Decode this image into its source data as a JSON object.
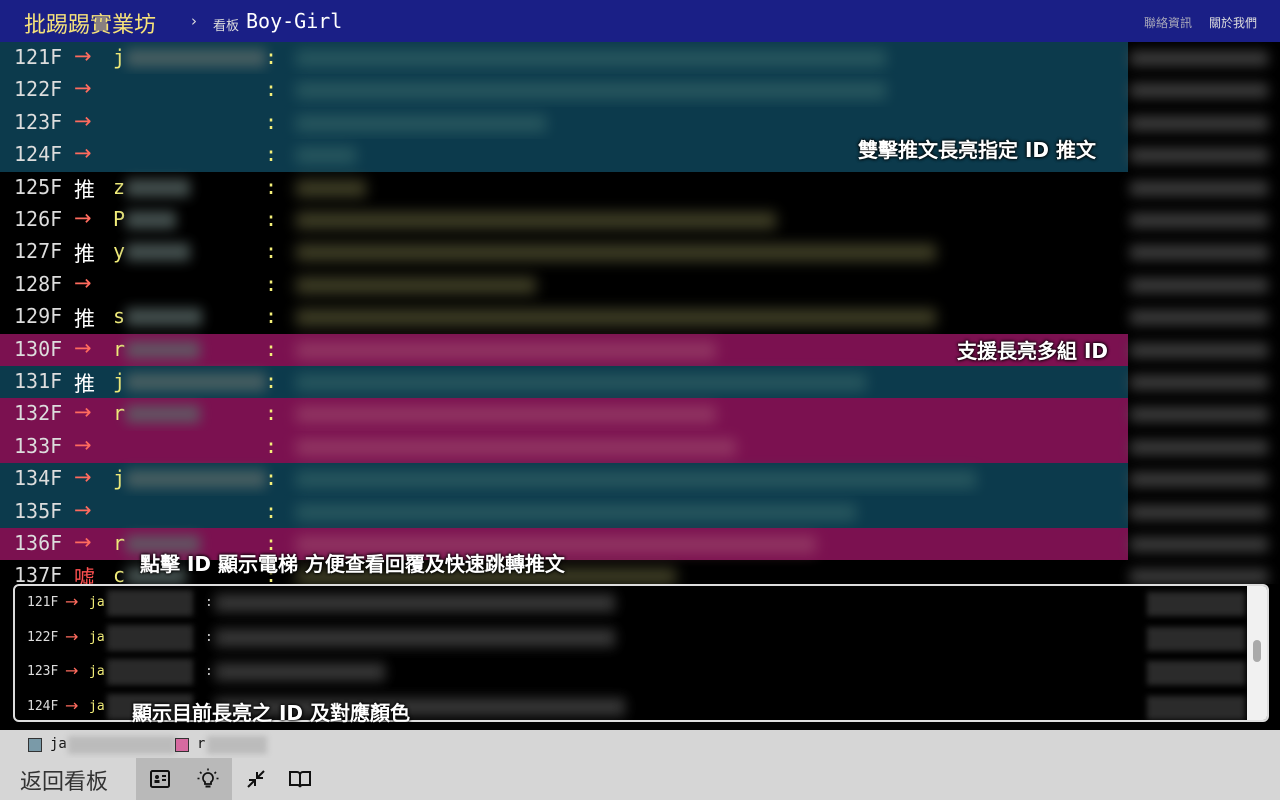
{
  "header": {
    "site_title": "批踢踢實業坊",
    "breadcrumb_sep": "›",
    "board_label": "看板",
    "board_name": "Boy-Girl",
    "nav_contact": "聯絡資訊",
    "nav_about": "關於我們"
  },
  "rows": [
    {
      "floor": "121F",
      "tag": "→",
      "tag_type": "arrow",
      "uid_initial": "j",
      "highlight": "teal"
    },
    {
      "floor": "122F",
      "tag": "→",
      "tag_type": "arrow",
      "uid_initial": "",
      "highlight": "teal"
    },
    {
      "floor": "123F",
      "tag": "→",
      "tag_type": "arrow",
      "uid_initial": "",
      "highlight": "teal"
    },
    {
      "floor": "124F",
      "tag": "→",
      "tag_type": "arrow",
      "uid_initial": "",
      "highlight": "teal"
    },
    {
      "floor": "125F",
      "tag": "推",
      "tag_type": "push",
      "uid_initial": "z",
      "highlight": ""
    },
    {
      "floor": "126F",
      "tag": "→",
      "tag_type": "arrow",
      "uid_initial": "P",
      "highlight": ""
    },
    {
      "floor": "127F",
      "tag": "推",
      "tag_type": "push",
      "uid_initial": "y",
      "highlight": ""
    },
    {
      "floor": "128F",
      "tag": "→",
      "tag_type": "arrow",
      "uid_initial": "",
      "highlight": ""
    },
    {
      "floor": "129F",
      "tag": "推",
      "tag_type": "push",
      "uid_initial": "s",
      "highlight": ""
    },
    {
      "floor": "130F",
      "tag": "→",
      "tag_type": "arrow",
      "uid_initial": "r",
      "highlight": "pink"
    },
    {
      "floor": "131F",
      "tag": "推",
      "tag_type": "push",
      "uid_initial": "j",
      "highlight": "teal"
    },
    {
      "floor": "132F",
      "tag": "→",
      "tag_type": "arrow",
      "uid_initial": "r",
      "highlight": "pink"
    },
    {
      "floor": "133F",
      "tag": "→",
      "tag_type": "arrow",
      "uid_initial": "",
      "highlight": "pink"
    },
    {
      "floor": "134F",
      "tag": "→",
      "tag_type": "arrow",
      "uid_initial": "j",
      "highlight": "teal"
    },
    {
      "floor": "135F",
      "tag": "→",
      "tag_type": "arrow",
      "uid_initial": "",
      "highlight": "teal"
    },
    {
      "floor": "136F",
      "tag": "→",
      "tag_type": "arrow",
      "uid_initial": "r",
      "highlight": "pink"
    },
    {
      "floor": "137F",
      "tag": "噓",
      "tag_type": "boo",
      "uid_initial": "c",
      "highlight": ""
    }
  ],
  "notes": {
    "dblclick_highlight": "雙擊推文長亮指定 ID 推文",
    "multi_highlight": "支援長亮多組 ID",
    "click_elevator": "點擊 ID 顯示電梯 方便查看回覆及快速跳轉推文",
    "show_current": "顯示目前長亮之 ID 及對應顏色"
  },
  "elevator": {
    "rows": [
      {
        "floor": "121F",
        "tag": "→",
        "uid_prefix": "ja"
      },
      {
        "floor": "122F",
        "tag": "→",
        "uid_prefix": "ja"
      },
      {
        "floor": "123F",
        "tag": "→",
        "uid_prefix": "ja"
      },
      {
        "floor": "124F",
        "tag": "→",
        "uid_prefix": "ja"
      }
    ],
    "colon": ":"
  },
  "legend": [
    {
      "prefix": "ja",
      "color": "#7a9aa8"
    },
    {
      "prefix": "r",
      "color": "#d66aa0"
    }
  ],
  "toolbar": {
    "back_label": "返回看板",
    "buttons": [
      {
        "icon": "id-card-icon",
        "active": true
      },
      {
        "icon": "lightbulb-icon",
        "active": true
      },
      {
        "icon": "collapse-arrows-icon",
        "active": false
      },
      {
        "icon": "open-book-icon",
        "active": false
      }
    ]
  },
  "colors": {
    "header_bg": "#1a1f86",
    "title_yellow": "#f6e27a",
    "teal_highlight": "#0c3a4c",
    "pink_highlight": "#7b1150",
    "arrow_red": "#ff6b5e",
    "toolbar_bg": "#d6d6d6"
  }
}
